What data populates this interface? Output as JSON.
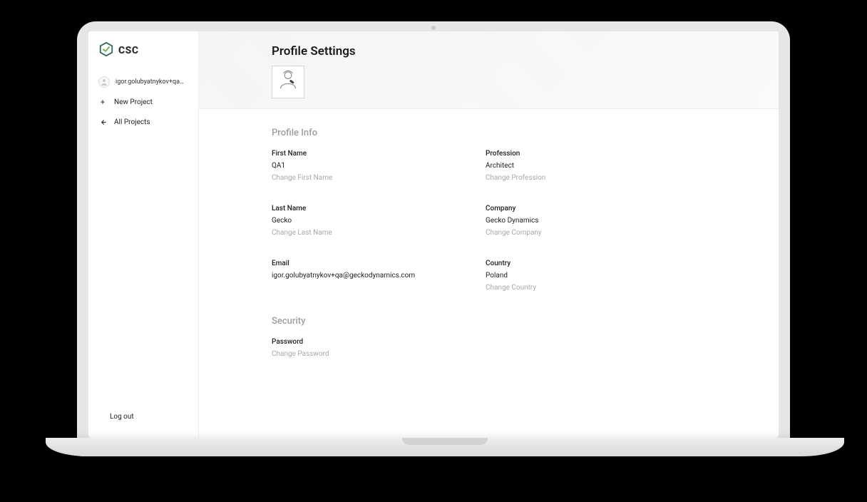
{
  "brand": {
    "name": "CSC"
  },
  "sidebar": {
    "user_email_truncated": "igor.golubyatnykov+qa@geck…",
    "new_project": "New Project",
    "all_projects": "All Projects",
    "logout": "Log out"
  },
  "header": {
    "title": "Profile Settings"
  },
  "profile": {
    "section_title": "Profile Info",
    "first_name": {
      "label": "First Name",
      "value": "QA1",
      "action": "Change First Name"
    },
    "last_name": {
      "label": "Last Name",
      "value": "Gecko",
      "action": "Change Last Name"
    },
    "email": {
      "label": "Email",
      "value": "igor.golubyatnykov+qa@geckodynamics.com"
    },
    "profession": {
      "label": "Profession",
      "value": "Architect",
      "action": "Change Profession"
    },
    "company": {
      "label": "Company",
      "value": "Gecko Dynamics",
      "action": "Change Company"
    },
    "country": {
      "label": "Country",
      "value": "Poland",
      "action": "Change Country"
    }
  },
  "security": {
    "section_title": "Security",
    "password": {
      "label": "Password",
      "action": "Change Password"
    }
  }
}
